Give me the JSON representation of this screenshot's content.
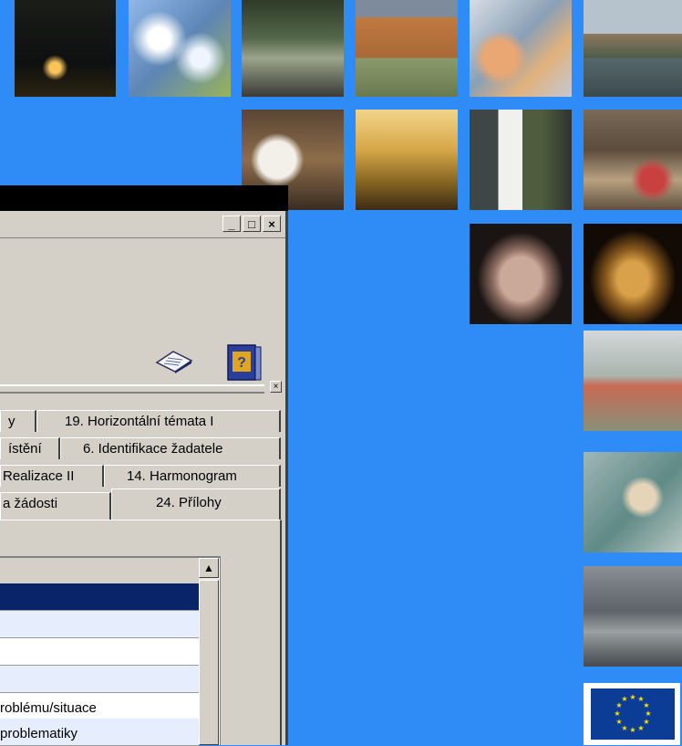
{
  "window": {
    "buttons": {
      "minimize": "_",
      "maximize": "□",
      "close": "×"
    },
    "subbar_close": "×"
  },
  "tabs": {
    "row1": [
      "y",
      "19. Horizontální témata I"
    ],
    "row2": [
      "ístění",
      "6. Identifikace žadatele"
    ],
    "row3": [
      "Realizace II",
      "14. Harmonogram"
    ],
    "row4": [
      "a žádosti",
      "24. Přílohy"
    ],
    "active": "24. Přílohy"
  },
  "grid": {
    "rows": [
      {
        "text": "",
        "style": "selected"
      },
      {
        "text": "",
        "style": "alt"
      },
      {
        "text": "",
        "style": "white"
      },
      {
        "text": "",
        "style": "alt"
      },
      {
        "text": "roblému/situace",
        "style": "white"
      },
      {
        "text": "problematiky",
        "style": "alt"
      },
      {
        "text": "",
        "style": "white"
      }
    ],
    "scroll_up": "▲"
  },
  "icons": {
    "toolbar": [
      "document-paper-icon",
      "help-book-icon"
    ],
    "logo": "eu-flag-icon"
  },
  "colors": {
    "background": "#2f8cf6",
    "selection": "#0a246a",
    "eu_blue": "#0b3d96",
    "eu_star": "#ffdd00"
  }
}
